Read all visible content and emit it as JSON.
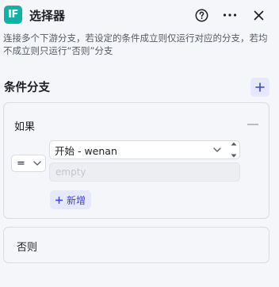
{
  "header": {
    "badge": "IF",
    "title": "选择器"
  },
  "description": "连接多个下游分支，若设定的条件成立则仅运行对应的分支，若均不成立则只运行“否则”分支",
  "branches": {
    "title": "条件分支"
  },
  "if_card": {
    "label": "如果",
    "condition": {
      "operator": "=",
      "variable": "开始 - wenan",
      "value_placeholder": "empty"
    },
    "add_label": "新增"
  },
  "else_card": {
    "label": "否则"
  },
  "colors": {
    "badge": "#0fb3a6",
    "accent": "#3f44c9",
    "accent_bg": "#e6e8fb"
  },
  "icons": [
    "if-badge-icon",
    "help-icon",
    "more-icon",
    "close-icon",
    "plus-icon",
    "minus-icon",
    "chevron-down-icon",
    "stepper-icon"
  ]
}
